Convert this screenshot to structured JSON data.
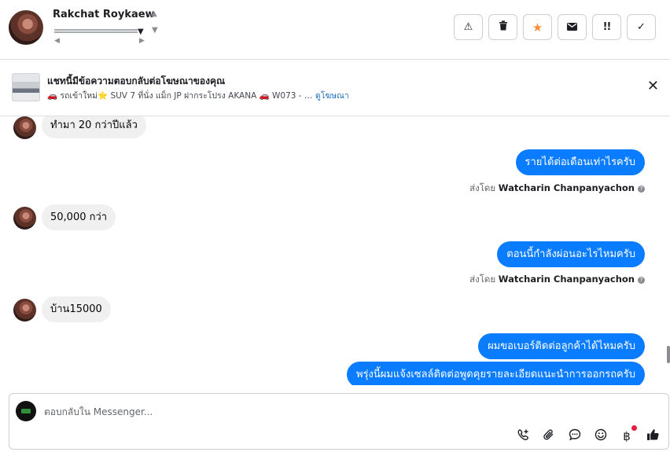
{
  "header": {
    "contact_name": "Rakchat Roykaew",
    "actions": [
      {
        "name": "report-button",
        "icon": "warning-icon",
        "glyph": "⚠"
      },
      {
        "name": "delete-button",
        "icon": "trash-icon",
        "glyph": "🗑"
      },
      {
        "name": "star-button",
        "icon": "star-icon",
        "glyph": "★"
      },
      {
        "name": "mark-unread-button",
        "icon": "envelope-icon",
        "glyph": "✉"
      },
      {
        "name": "follow-up-button",
        "icon": "follow-up-icon",
        "glyph": "!!"
      },
      {
        "name": "mark-done-button",
        "icon": "check-icon",
        "glyph": "✓"
      }
    ],
    "star_color": "#f7923b"
  },
  "ad_banner": {
    "title": "แชทนี้มีข้อความตอบกลับต่อโฆษณาของคุณ",
    "subtitle": "🚗 รถเข้าใหม่⭐ SUV 7 ที่นั่ง แม็ก JP ฝากระโปรง AKANA 🚗 W073 - Paj...",
    "link": "ดูโฆษณา",
    "close_glyph": "✕"
  },
  "messages": [
    {
      "direction": "in",
      "text": "ทำมา 20 กว่าปีแล้ว"
    },
    {
      "direction": "out",
      "text": "รายได้ต่อเดือนเท่าไรครับ",
      "sent_by_prefix": "ส่งโดย",
      "sent_by": "Watcharin Chanpanyachon"
    },
    {
      "direction": "in",
      "text": "50,000 กว่า"
    },
    {
      "direction": "out",
      "text": "ตอนนี้กำลังผ่อนอะไรไหมครับ",
      "sent_by_prefix": "ส่งโดย",
      "sent_by": "Watcharin Chanpanyachon"
    },
    {
      "direction": "in",
      "text": "บ้าน15000"
    },
    {
      "direction": "out",
      "text": "ผมขอเบอร์ติดต่อลูกค้าได้ไหมครับ"
    },
    {
      "direction": "out",
      "text": "พรุ่งนี้ผมแจ้งเซลล์ติดต่อพูดคุยรายละเอียดแนะนำการออกรถครับ"
    }
  ],
  "composer": {
    "placeholder": "ตอบกลับใน Messenger...",
    "tools": [
      {
        "name": "call-button",
        "icon": "phone-plus-icon",
        "glyph": "✆"
      },
      {
        "name": "attach-button",
        "icon": "paperclip-icon",
        "glyph": "📎"
      },
      {
        "name": "saved-replies-button",
        "icon": "chat-bubble-icon",
        "glyph": "💬"
      },
      {
        "name": "emoji-button",
        "icon": "smiley-icon",
        "glyph": "☺"
      },
      {
        "name": "payment-button",
        "icon": "baht-icon",
        "glyph": "฿"
      },
      {
        "name": "like-button",
        "icon": "thumbs-up-icon",
        "glyph": "👍"
      }
    ]
  },
  "colors": {
    "outgoing_bubble": "#0a7cff",
    "incoming_bubble": "#f0f0f0",
    "link": "#1d6fb8"
  }
}
